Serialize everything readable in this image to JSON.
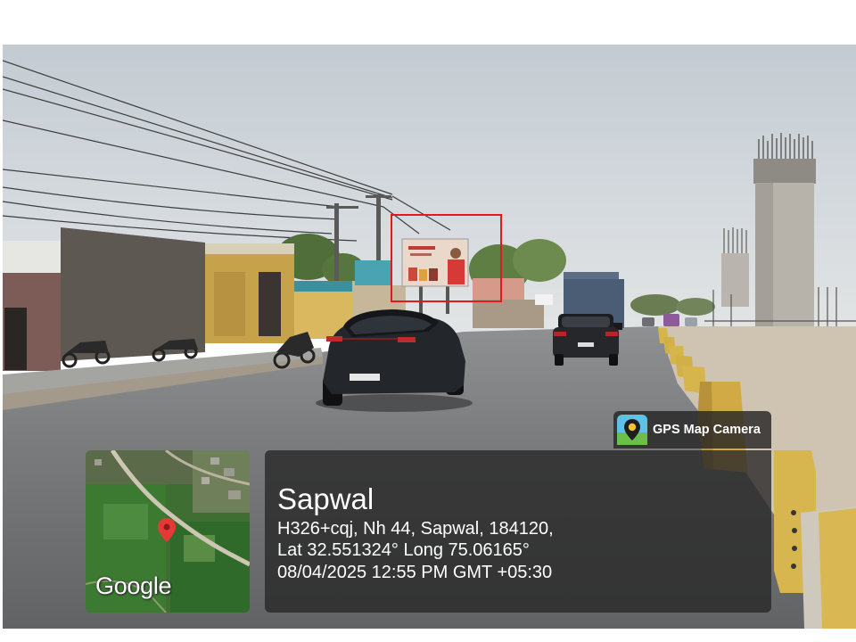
{
  "overlay": {
    "app_badge": {
      "label": "GPS Map Camera",
      "icon": "gps-map-camera-icon"
    },
    "map": {
      "logo": "Google",
      "marker_icon": "location-pin-icon"
    },
    "location": {
      "place": "Sapwal",
      "address": "H326+cqj, Nh 44, Sapwal, 184120,",
      "coordinates": "Lat 32.551324° Long 75.06165°",
      "timestamp": "08/04/2025 12:55 PM GMT +05:30"
    }
  },
  "highlight": {
    "color": "#e3191b",
    "target": "billboard"
  },
  "colors": {
    "panel": "#282828",
    "text": "#ffffff",
    "pin": "#e53935"
  }
}
